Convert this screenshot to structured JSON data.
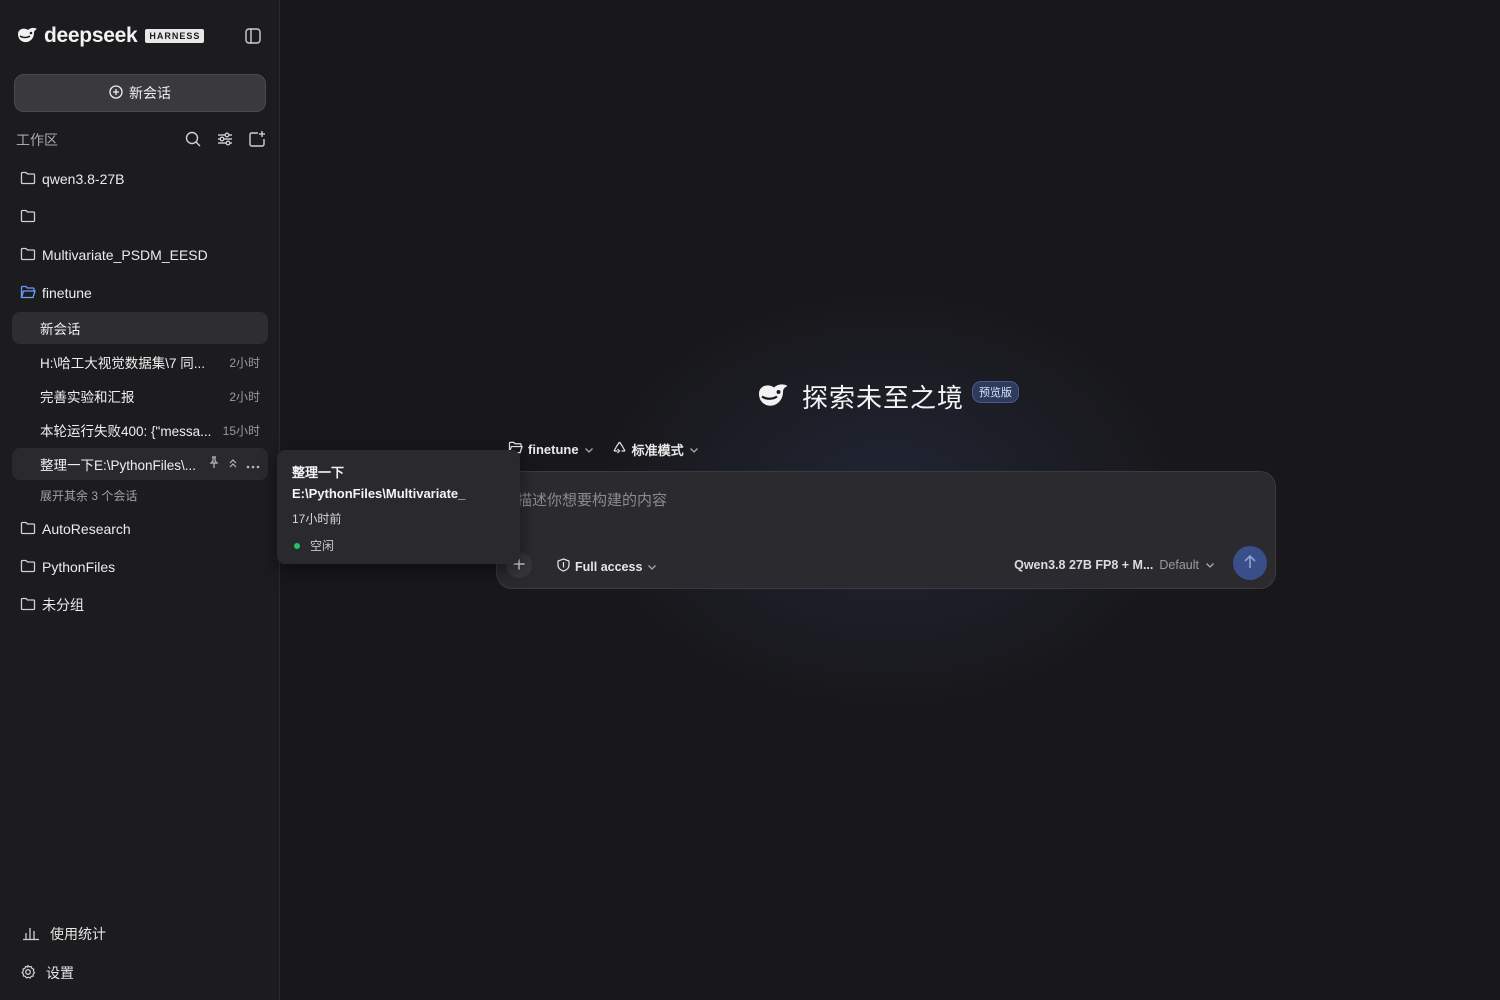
{
  "brand": {
    "logo_text": "deepseek",
    "badge": "HARNESS"
  },
  "sidebar": {
    "new_chat_label": "新会话",
    "workspace_label": "工作区",
    "folders": [
      {
        "name": "qwen3.8-27B"
      },
      {
        "name": ""
      },
      {
        "name": "Multivariate_PSDM_EESD"
      },
      {
        "name": "finetune",
        "open": true,
        "sessions": [
          {
            "title": "新会话",
            "time": "",
            "state": "active"
          },
          {
            "title": "H:\\哈工大视觉数据集\\7 同...",
            "time": "2小时"
          },
          {
            "title": "完善实验和汇报",
            "time": "2小时"
          },
          {
            "title": "本轮运行失败400: {\"messa...",
            "time": "15小时"
          },
          {
            "title": "整理一下E:\\PythonFiles\\...",
            "time": "",
            "state": "hover"
          }
        ],
        "expand_more": "展开其余 3 个会话"
      },
      {
        "name": "AutoResearch"
      },
      {
        "name": "PythonFiles"
      },
      {
        "name": "未分组"
      }
    ],
    "usage_stats": "使用统计",
    "settings": "设置"
  },
  "tooltip": {
    "title_line1": "整理一下",
    "title_line2": "E:\\PythonFiles\\Multivariate_",
    "time": "17小时前",
    "status": "空闲",
    "status_color": "#22c55e"
  },
  "main": {
    "hero_title": "探索未至之境",
    "hero_badge": "预览版",
    "project": "finetune",
    "mode": "标准模式",
    "composer": {
      "placeholder": "描述你想要构建的内容",
      "access": "Full access",
      "model": "Qwen3.8 27B FP8 + M...",
      "model_variant": "Default"
    },
    "accent_color": "#3a4f8a"
  }
}
